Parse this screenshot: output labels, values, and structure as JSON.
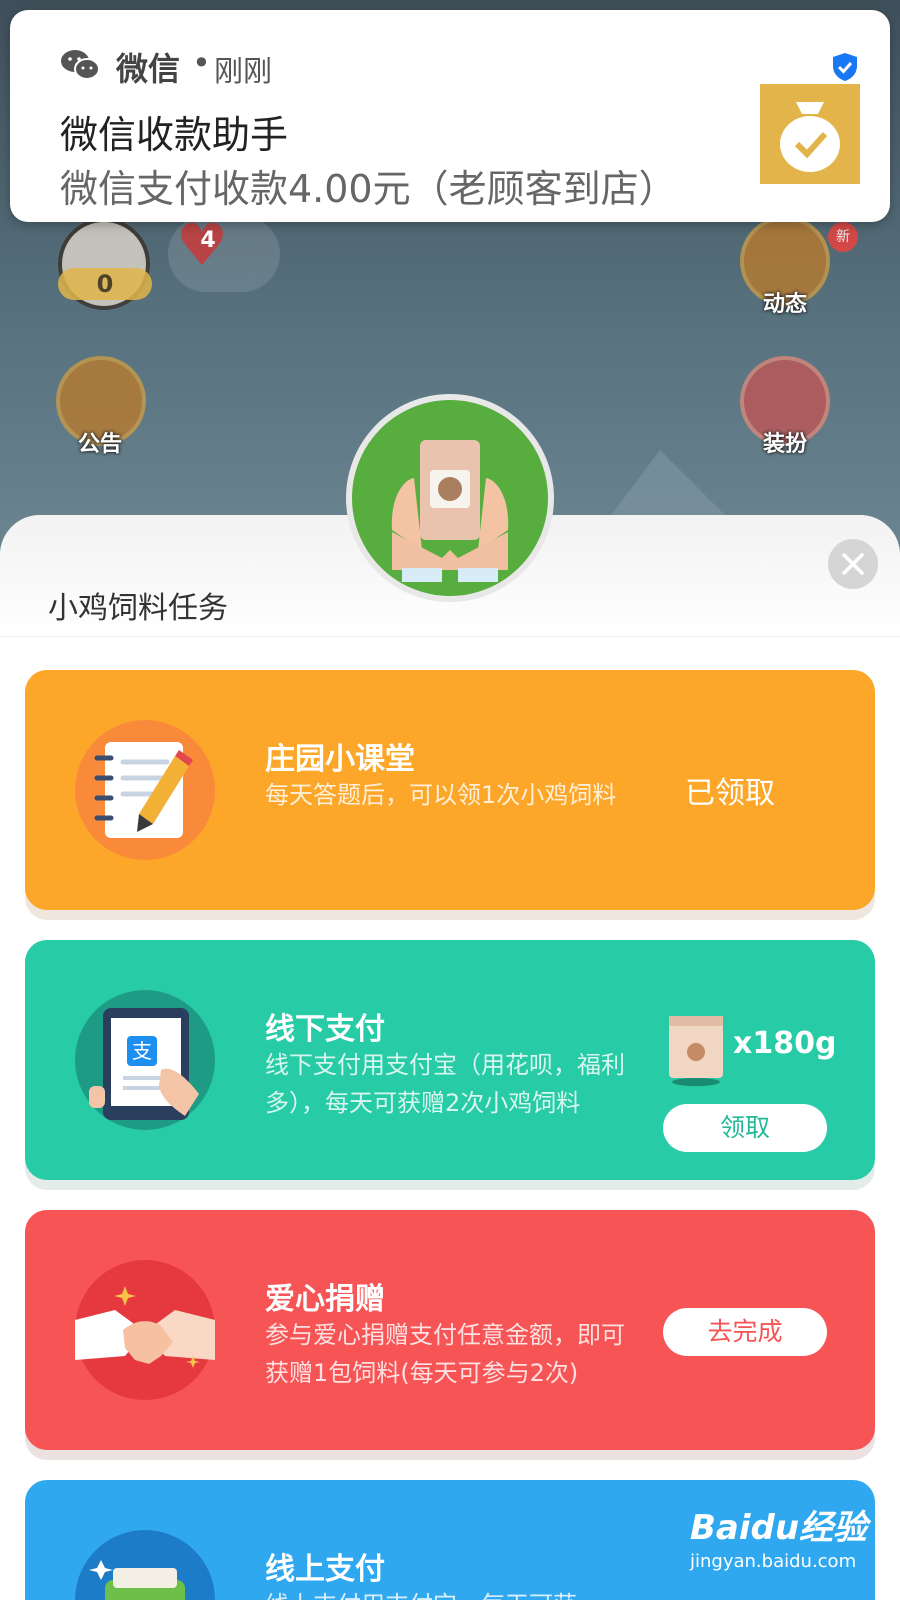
{
  "notification": {
    "app_name": "微信",
    "separator": "•",
    "time": "刚刚",
    "title": "微信收款助手",
    "body": "微信支付收款4.00元（老顾客到店）",
    "icon": "wechat-icon",
    "verified_icon": "shield-check-icon"
  },
  "game_hud": {
    "level_badge": "0",
    "hearts": "4",
    "new_badge": "新",
    "buttons": [
      {
        "label": "动态",
        "icon": "mailbox-icon"
      },
      {
        "label": "公告",
        "icon": "megaphone-icon"
      },
      {
        "label": "装扮",
        "icon": "dress-up-icon"
      }
    ]
  },
  "sheet": {
    "title": "小鸡饲料任务",
    "close_icon": "close-icon"
  },
  "tasks": [
    {
      "title": "庄园小课堂",
      "desc": "每天答题后，可以领1次小鸡饲料",
      "status": "已领取",
      "icon": "notebook-pencil-icon",
      "color": "#fca72a"
    },
    {
      "title": "线下支付",
      "desc": "线下支付用支付宝（用花呗，福利多），每天可获赠2次小鸡饲料",
      "reward": "x180g",
      "button": "领取",
      "icon": "tablet-alipay-icon",
      "color": "#27cba6"
    },
    {
      "title": "爱心捐赠",
      "desc": "参与爱心捐赠支付任意金额，即可获赠1包饲料(每天可参与2次)",
      "button": "去完成",
      "icon": "handshake-icon",
      "color": "#f65455"
    },
    {
      "title": "线上支付",
      "desc": "线上支付用支付宝，每天可获",
      "icon": "wallet-icon",
      "color": "#2fa8ef"
    }
  ],
  "watermark": {
    "brand": "Baidu经验",
    "url": "jingyan.baidu.com"
  }
}
